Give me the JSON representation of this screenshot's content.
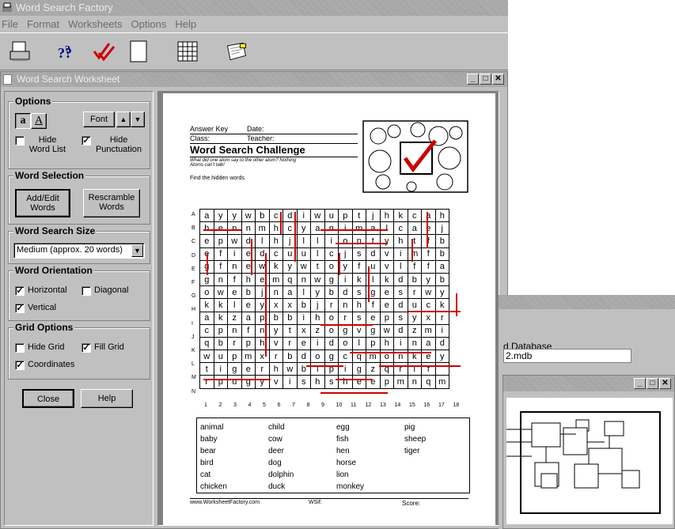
{
  "app": {
    "title": "Word Search Factory",
    "menu": [
      "File",
      "Format",
      "Worksheets",
      "Options",
      "Help"
    ]
  },
  "child_window": {
    "title": "Word Search Worksheet"
  },
  "options": {
    "label": "Options",
    "font_label": "Font",
    "hide_word_list": "Hide Word List",
    "hide_punctuation": "Hide Punctuation",
    "hide_punctuation_checked": true
  },
  "word_selection": {
    "label": "Word Selection",
    "add_edit": "Add/Edit Words",
    "rescramble": "Rescramble Words"
  },
  "size": {
    "label": "Word Search Size",
    "selected": "Medium  (approx. 20 words)"
  },
  "orientation": {
    "label": "Word Orientation",
    "horizontal": "Horizontal",
    "diagonal": "Diagonal",
    "vertical": "Vertical"
  },
  "grid_options": {
    "label": "Grid Options",
    "hide_grid": "Hide Grid",
    "fill_grid": "Fill Grid",
    "coordinates": "Coordinates"
  },
  "buttons": {
    "close": "Close",
    "help": "Help"
  },
  "sheet": {
    "answer_key": "Answer Key",
    "date": "Date:",
    "class": "Class:",
    "teacher": "Teacher:",
    "title": "Word Search Challenge",
    "subtitle1": "What did one atom say to the other atom? Nothing",
    "subtitle2": "Atoms can't talk!",
    "instructions": "Find the hidden words.",
    "footer_url": "www.WorksheetFactory.com",
    "footer_wsf": "WSif:",
    "footer_score": "Score:",
    "row_labels": [
      "A",
      "B",
      "C",
      "D",
      "E",
      "F",
      "G",
      "H",
      "I",
      "J",
      "K",
      "L",
      "M",
      "N"
    ],
    "col_labels": [
      "1",
      "2",
      "3",
      "4",
      "5",
      "6",
      "7",
      "8",
      "9",
      "10",
      "11",
      "12",
      "13",
      "14",
      "15",
      "16",
      "17",
      "18"
    ],
    "grid": [
      "ayywbcdiwuptjhkcah",
      "hennmhcyanimalcaej",
      "epwdlhjlliontyhtfb",
      "efiedcuulcjsdvimfb",
      "gfnewkywtoyfuvlffa",
      "gnfhemqnwgiklkdbyb",
      "owebjnalybdsgesrwy",
      "kkleyxxbjrnhfeduck",
      "akzapbbihorsepsyxrl",
      "cpnfnytxzogvgwdzmi",
      "qbrphvreidolphinad",
      "wupmxrbdogcqmonkey",
      "tigerhwblpigzqrlf",
      "rpugyvishsheepmnqmpt"
    ],
    "words": [
      [
        "animal",
        "baby",
        "bear",
        "bird",
        "cat",
        "chicken"
      ],
      [
        "child",
        "cow",
        "deer",
        "dog",
        "dolphin",
        "duck"
      ],
      [
        "egg",
        "fish",
        "hen",
        "horse",
        "lion",
        "monkey"
      ],
      [
        "pig",
        "sheep",
        "tiger"
      ]
    ]
  },
  "background": {
    "db_label": "d Database",
    "db_file": "2.mdb"
  }
}
